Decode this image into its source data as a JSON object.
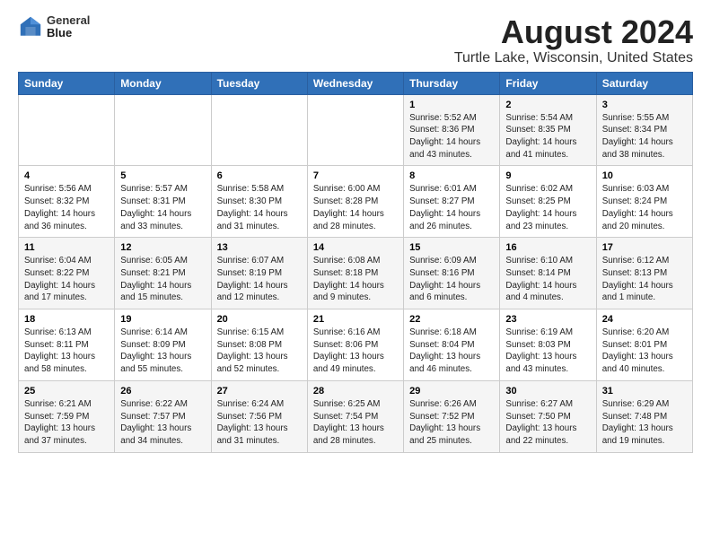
{
  "header": {
    "logo_line1": "General",
    "logo_line2": "Blue",
    "title": "August 2024",
    "subtitle": "Turtle Lake, Wisconsin, United States"
  },
  "weekdays": [
    "Sunday",
    "Monday",
    "Tuesday",
    "Wednesday",
    "Thursday",
    "Friday",
    "Saturday"
  ],
  "weeks": [
    [
      {
        "day": "",
        "info": ""
      },
      {
        "day": "",
        "info": ""
      },
      {
        "day": "",
        "info": ""
      },
      {
        "day": "",
        "info": ""
      },
      {
        "day": "1",
        "info": "Sunrise: 5:52 AM\nSunset: 8:36 PM\nDaylight: 14 hours\nand 43 minutes."
      },
      {
        "day": "2",
        "info": "Sunrise: 5:54 AM\nSunset: 8:35 PM\nDaylight: 14 hours\nand 41 minutes."
      },
      {
        "day": "3",
        "info": "Sunrise: 5:55 AM\nSunset: 8:34 PM\nDaylight: 14 hours\nand 38 minutes."
      }
    ],
    [
      {
        "day": "4",
        "info": "Sunrise: 5:56 AM\nSunset: 8:32 PM\nDaylight: 14 hours\nand 36 minutes."
      },
      {
        "day": "5",
        "info": "Sunrise: 5:57 AM\nSunset: 8:31 PM\nDaylight: 14 hours\nand 33 minutes."
      },
      {
        "day": "6",
        "info": "Sunrise: 5:58 AM\nSunset: 8:30 PM\nDaylight: 14 hours\nand 31 minutes."
      },
      {
        "day": "7",
        "info": "Sunrise: 6:00 AM\nSunset: 8:28 PM\nDaylight: 14 hours\nand 28 minutes."
      },
      {
        "day": "8",
        "info": "Sunrise: 6:01 AM\nSunset: 8:27 PM\nDaylight: 14 hours\nand 26 minutes."
      },
      {
        "day": "9",
        "info": "Sunrise: 6:02 AM\nSunset: 8:25 PM\nDaylight: 14 hours\nand 23 minutes."
      },
      {
        "day": "10",
        "info": "Sunrise: 6:03 AM\nSunset: 8:24 PM\nDaylight: 14 hours\nand 20 minutes."
      }
    ],
    [
      {
        "day": "11",
        "info": "Sunrise: 6:04 AM\nSunset: 8:22 PM\nDaylight: 14 hours\nand 17 minutes."
      },
      {
        "day": "12",
        "info": "Sunrise: 6:05 AM\nSunset: 8:21 PM\nDaylight: 14 hours\nand 15 minutes."
      },
      {
        "day": "13",
        "info": "Sunrise: 6:07 AM\nSunset: 8:19 PM\nDaylight: 14 hours\nand 12 minutes."
      },
      {
        "day": "14",
        "info": "Sunrise: 6:08 AM\nSunset: 8:18 PM\nDaylight: 14 hours\nand 9 minutes."
      },
      {
        "day": "15",
        "info": "Sunrise: 6:09 AM\nSunset: 8:16 PM\nDaylight: 14 hours\nand 6 minutes."
      },
      {
        "day": "16",
        "info": "Sunrise: 6:10 AM\nSunset: 8:14 PM\nDaylight: 14 hours\nand 4 minutes."
      },
      {
        "day": "17",
        "info": "Sunrise: 6:12 AM\nSunset: 8:13 PM\nDaylight: 14 hours\nand 1 minute."
      }
    ],
    [
      {
        "day": "18",
        "info": "Sunrise: 6:13 AM\nSunset: 8:11 PM\nDaylight: 13 hours\nand 58 minutes."
      },
      {
        "day": "19",
        "info": "Sunrise: 6:14 AM\nSunset: 8:09 PM\nDaylight: 13 hours\nand 55 minutes."
      },
      {
        "day": "20",
        "info": "Sunrise: 6:15 AM\nSunset: 8:08 PM\nDaylight: 13 hours\nand 52 minutes."
      },
      {
        "day": "21",
        "info": "Sunrise: 6:16 AM\nSunset: 8:06 PM\nDaylight: 13 hours\nand 49 minutes."
      },
      {
        "day": "22",
        "info": "Sunrise: 6:18 AM\nSunset: 8:04 PM\nDaylight: 13 hours\nand 46 minutes."
      },
      {
        "day": "23",
        "info": "Sunrise: 6:19 AM\nSunset: 8:03 PM\nDaylight: 13 hours\nand 43 minutes."
      },
      {
        "day": "24",
        "info": "Sunrise: 6:20 AM\nSunset: 8:01 PM\nDaylight: 13 hours\nand 40 minutes."
      }
    ],
    [
      {
        "day": "25",
        "info": "Sunrise: 6:21 AM\nSunset: 7:59 PM\nDaylight: 13 hours\nand 37 minutes."
      },
      {
        "day": "26",
        "info": "Sunrise: 6:22 AM\nSunset: 7:57 PM\nDaylight: 13 hours\nand 34 minutes."
      },
      {
        "day": "27",
        "info": "Sunrise: 6:24 AM\nSunset: 7:56 PM\nDaylight: 13 hours\nand 31 minutes."
      },
      {
        "day": "28",
        "info": "Sunrise: 6:25 AM\nSunset: 7:54 PM\nDaylight: 13 hours\nand 28 minutes."
      },
      {
        "day": "29",
        "info": "Sunrise: 6:26 AM\nSunset: 7:52 PM\nDaylight: 13 hours\nand 25 minutes."
      },
      {
        "day": "30",
        "info": "Sunrise: 6:27 AM\nSunset: 7:50 PM\nDaylight: 13 hours\nand 22 minutes."
      },
      {
        "day": "31",
        "info": "Sunrise: 6:29 AM\nSunset: 7:48 PM\nDaylight: 13 hours\nand 19 minutes."
      }
    ]
  ]
}
